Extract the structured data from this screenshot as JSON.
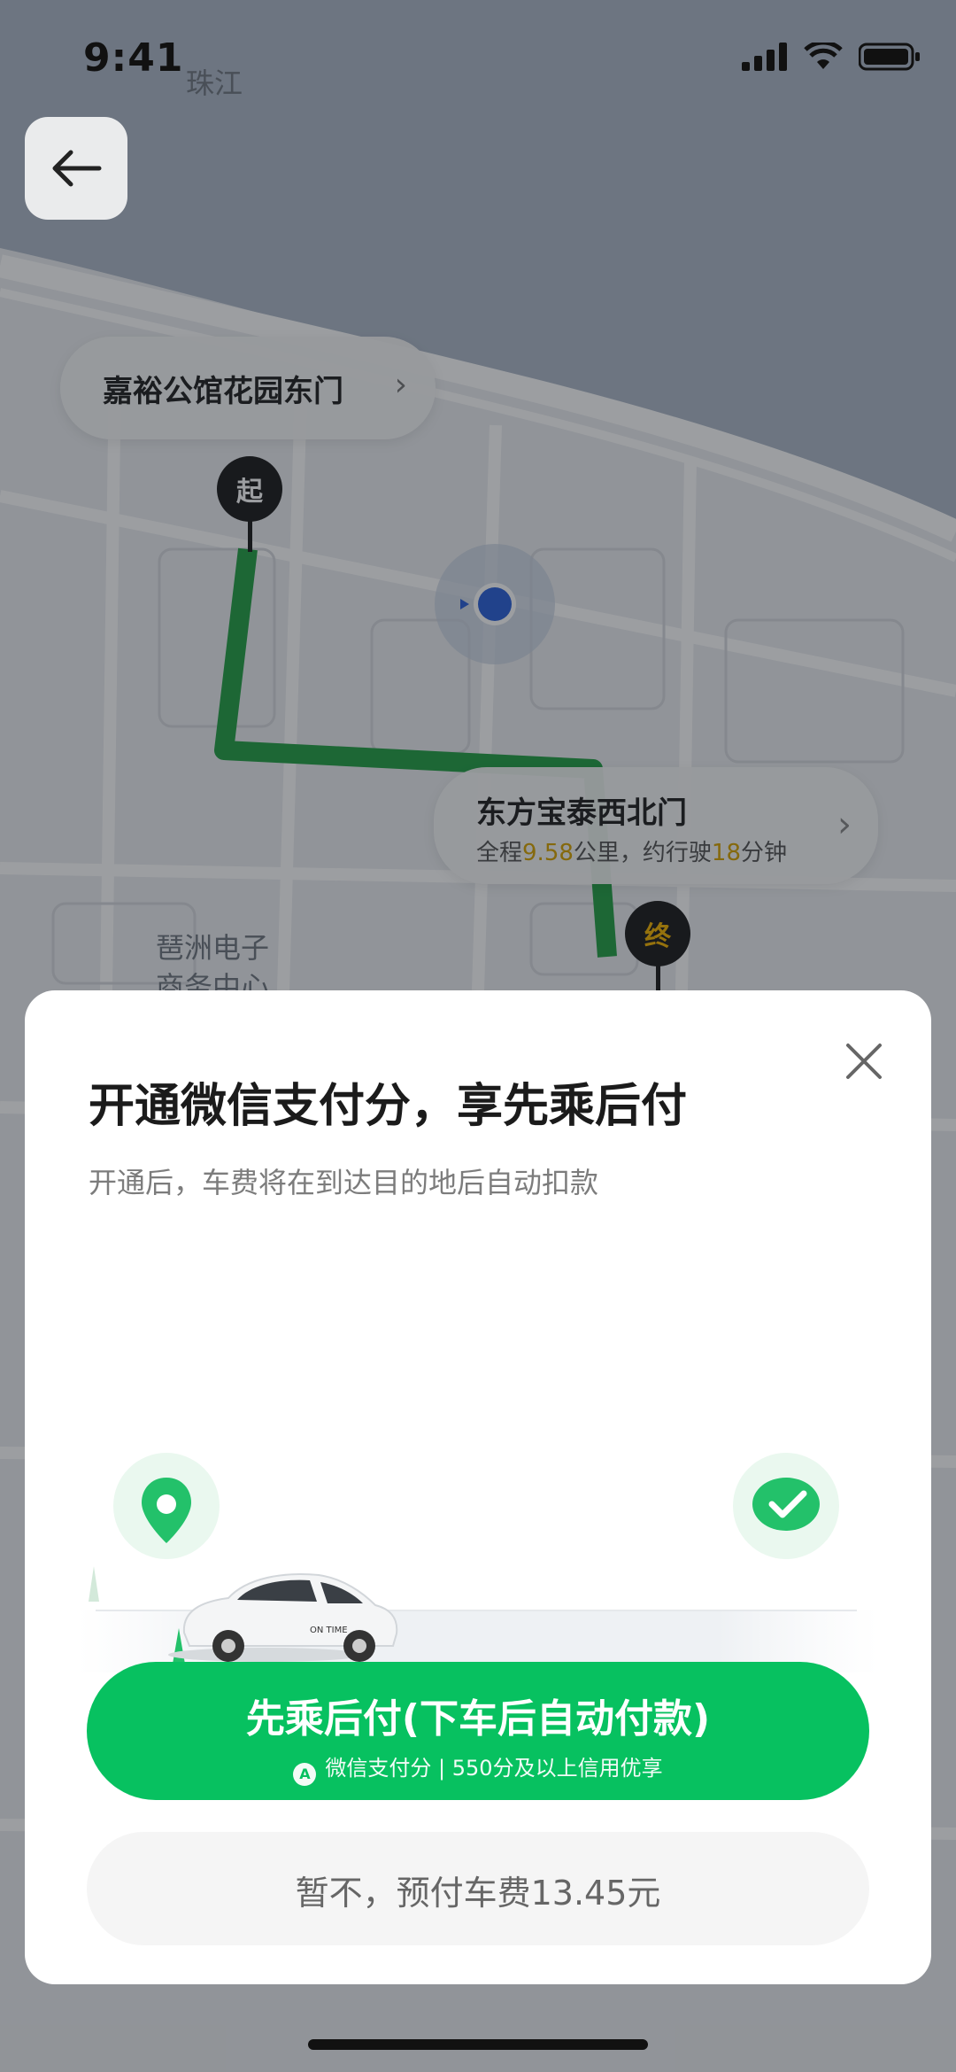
{
  "status_bar": {
    "time": "9:41"
  },
  "map": {
    "labels": {
      "river": "珠江",
      "area_line1": "琶洲电子",
      "area_line2": "商务中心"
    },
    "start_poi": {
      "name": "嘉裕公馆花园东门",
      "pin_label": "起"
    },
    "end_poi": {
      "name": "东方宝泰西北门",
      "route_prefix": "全程",
      "distance": "9.58",
      "route_mid": "公里，约行驶",
      "duration": "18",
      "route_suffix": "分钟",
      "pin_label": "终"
    }
  },
  "sheet": {
    "title": "开通微信支付分，享先乘后付",
    "subtitle": "开通后，车费将在到达目的地后自动扣款",
    "car_text": "ON TIME",
    "primary_button": {
      "label": "先乘后付(下车后自动付款)",
      "sub_label": "微信支付分 | 550分及以上信用优享",
      "badge": "A"
    },
    "secondary_button": {
      "label": "暂不，预付车费13.45元"
    }
  },
  "colors": {
    "accent": "#07c160",
    "route": "#25a146",
    "highlight": "#d8a400"
  }
}
